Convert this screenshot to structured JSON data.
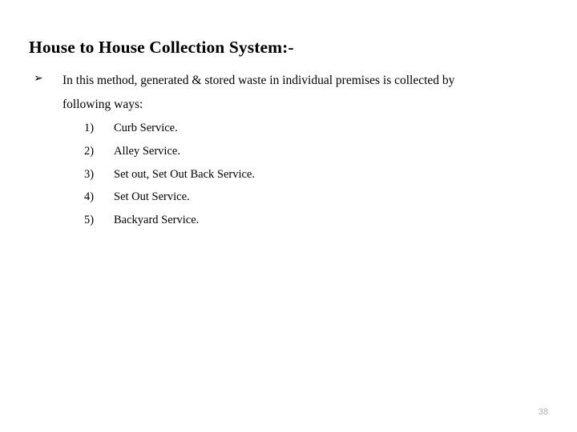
{
  "slide": {
    "page_number": "38",
    "background_color": "#ffffff",
    "text_color": "#000000",
    "page_number_color": "#b0b0b0"
  },
  "title": {
    "text": "House to House Collection System:-"
  },
  "bullet": {
    "marker": "➢",
    "marker_name": "arrowhead-bullet-icon",
    "line1": "In this method, generated & stored waste in individual premises is collected by",
    "line2": "following ways:"
  },
  "list": {
    "items": [
      {
        "number": "1)",
        "label": "Curb Service."
      },
      {
        "number": "2)",
        "label": "Alley Service."
      },
      {
        "number": "3)",
        "label": "Set out, Set Out Back Service."
      },
      {
        "number": "4)",
        "label": "Set Out Service."
      },
      {
        "number": "5)",
        "label": "Backyard Service."
      }
    ]
  }
}
